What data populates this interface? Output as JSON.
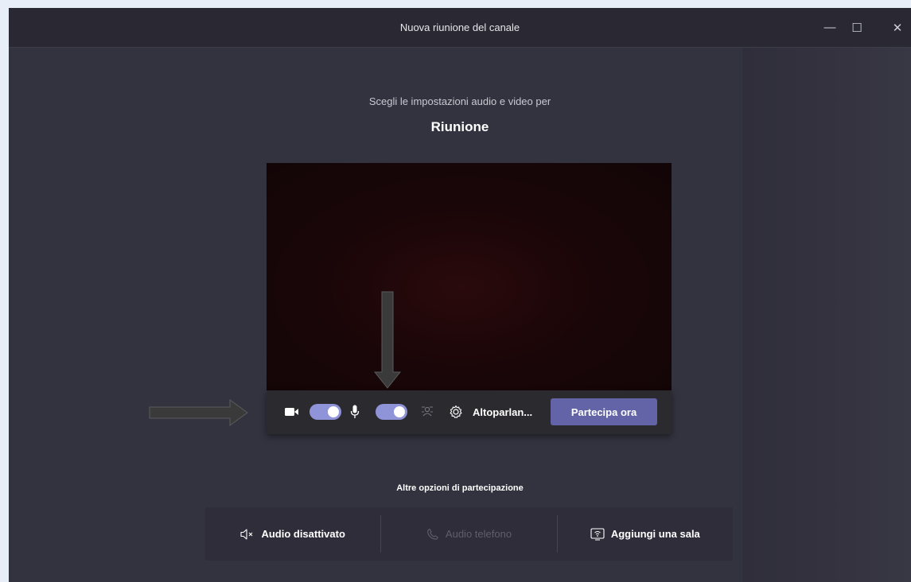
{
  "window": {
    "title": "Nuova riunione del canale",
    "controls": {
      "minimize": "—",
      "maximize": "☐",
      "close": "✕"
    }
  },
  "prejoin": {
    "subtitle": "Scegli le impostazioni audio e video per",
    "meeting_name": "Riunione"
  },
  "controls": {
    "camera_on": true,
    "mic_on": true,
    "speaker_label": "Altoparlan...",
    "join_label": "Partecipa ora",
    "accent": "#6264a7",
    "toggle_color": "#8f93d8"
  },
  "more_options": {
    "title": "Altre opzioni di partecipazione",
    "items": [
      {
        "label": "Audio disattivato",
        "icon": "speaker-muted-icon",
        "enabled": true
      },
      {
        "label": "Audio telefono",
        "icon": "phone-icon",
        "enabled": false
      },
      {
        "label": "Aggiungi una sala",
        "icon": "room-cast-icon",
        "enabled": true
      }
    ]
  }
}
